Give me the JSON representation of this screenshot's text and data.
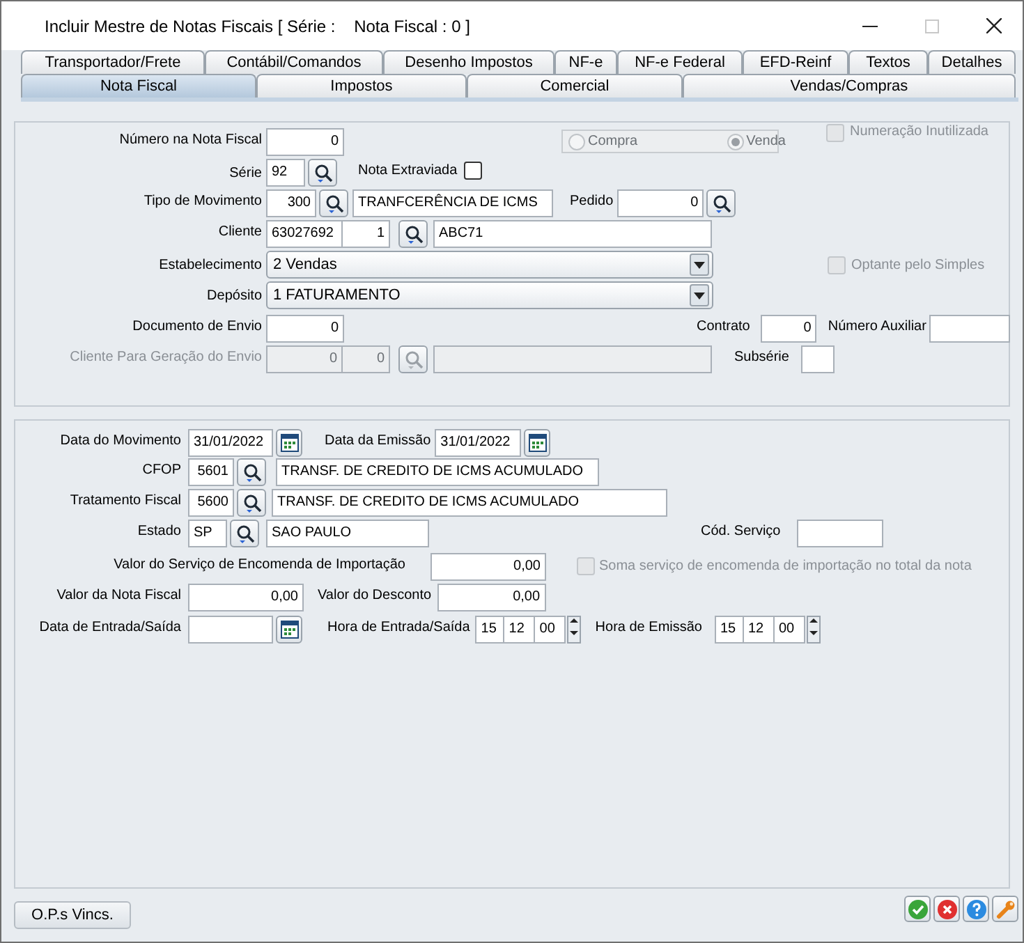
{
  "window": {
    "title": "Incluir Mestre de Notas Fiscais [ Série :    Nota Fiscal : 0 ]"
  },
  "tabs_row_1": [
    {
      "label": "Transportador/Frete",
      "selected": false
    },
    {
      "label": "Contábil/Comandos",
      "selected": false
    },
    {
      "label": "Desenho Impostos",
      "selected": false
    },
    {
      "label": "NF-e",
      "selected": false
    },
    {
      "label": "NF-e Federal",
      "selected": false
    },
    {
      "label": "EFD-Reinf",
      "selected": false
    },
    {
      "label": "Textos",
      "selected": false
    },
    {
      "label": "Detalhes",
      "selected": false
    }
  ],
  "tabs_row_2": [
    {
      "label": "Nota Fiscal",
      "selected": true
    },
    {
      "label": "Impostos",
      "selected": false
    },
    {
      "label": "Comercial",
      "selected": false
    },
    {
      "label": "Vendas/Compras",
      "selected": false
    }
  ],
  "document": {
    "numero_nota_fiscal": {
      "label": "Número na Nota Fiscal",
      "value": "0"
    },
    "operacao": [
      {
        "label": "Compra",
        "selected": false
      },
      {
        "label": "Venda",
        "selected": true
      }
    ],
    "numeracao_inutilizada": {
      "label": "Numeração Inutilizada",
      "checked": false,
      "disabled": true
    },
    "serie": {
      "label": "Série",
      "value": "92"
    },
    "nota_extraviada": {
      "label": "Nota Extraviada",
      "checked": false,
      "disabled": false
    },
    "tipo_movimento": {
      "label": "Tipo de Movimento",
      "code": "300",
      "description": "TRANFCERÊNCIA DE ICMS"
    },
    "pedido": {
      "label": "Pedido",
      "value": "0"
    },
    "cliente": {
      "label": "Cliente",
      "code": "63027692",
      "branch": "1",
      "name": "ABC71"
    },
    "estabelecimento": {
      "label": "Estabelecimento",
      "value": "2 Vendas"
    },
    "optante_simples": {
      "label": "Optante pelo Simples",
      "checked": false,
      "disabled": true
    },
    "deposito": {
      "label": "Depósito",
      "value": "1 FATURAMENTO"
    },
    "documento_envio": {
      "label": "Documento de Envio",
      "value": "0"
    },
    "contrato": {
      "label": "Contrato",
      "value": "0"
    },
    "numero_auxiliar": {
      "label": "Número Auxiliar"
    },
    "cliente_geracao_envio": {
      "label": "Cliente Para Geração do Envio",
      "code": "0",
      "branch": "0",
      "disabled": true
    },
    "subserie": {
      "label": "Subsérie"
    }
  },
  "movimento": {
    "data_movimento": {
      "label": "Data do Movimento",
      "value": "31/01/2022"
    },
    "data_emissao": {
      "label": "Data da Emissão",
      "value": "31/01/2022"
    },
    "cfop": {
      "label": "CFOP",
      "code": "5601",
      "description": "TRANSF. DE CREDITO DE ICMS ACUMULADO"
    },
    "tratamento_fiscal": {
      "label": "Tratamento Fiscal",
      "code": "5600",
      "description": "TRANSF. DE CREDITO DE ICMS ACUMULADO"
    },
    "estado": {
      "label": "Estado",
      "code": "SP",
      "description": "SAO PAULO"
    },
    "cod_servico": {
      "label": "Cód. Serviço"
    },
    "valor_servico_encomenda": {
      "label": "Valor do Serviço de Encomenda de Importação",
      "value": "0,00"
    },
    "soma_servico": {
      "label": "Soma serviço de encomenda de importação no total da nota",
      "checked": false,
      "disabled": true
    },
    "valor_nota_fiscal": {
      "label": "Valor da Nota Fiscal",
      "value": "0,00"
    },
    "valor_desconto": {
      "label": "Valor do Desconto",
      "value": "0,00"
    },
    "data_entrada_saida": {
      "label": "Data de Entrada/Saída"
    },
    "hora_entrada_saida": {
      "label": "Hora de Entrada/Saída",
      "hour": "15",
      "minute": "12",
      "second": "00"
    },
    "hora_emissao": {
      "label": "Hora de Emissão",
      "hour": "15",
      "minute": "12",
      "second": "00"
    }
  },
  "footer": {
    "button": "O.P.s Vincs."
  }
}
